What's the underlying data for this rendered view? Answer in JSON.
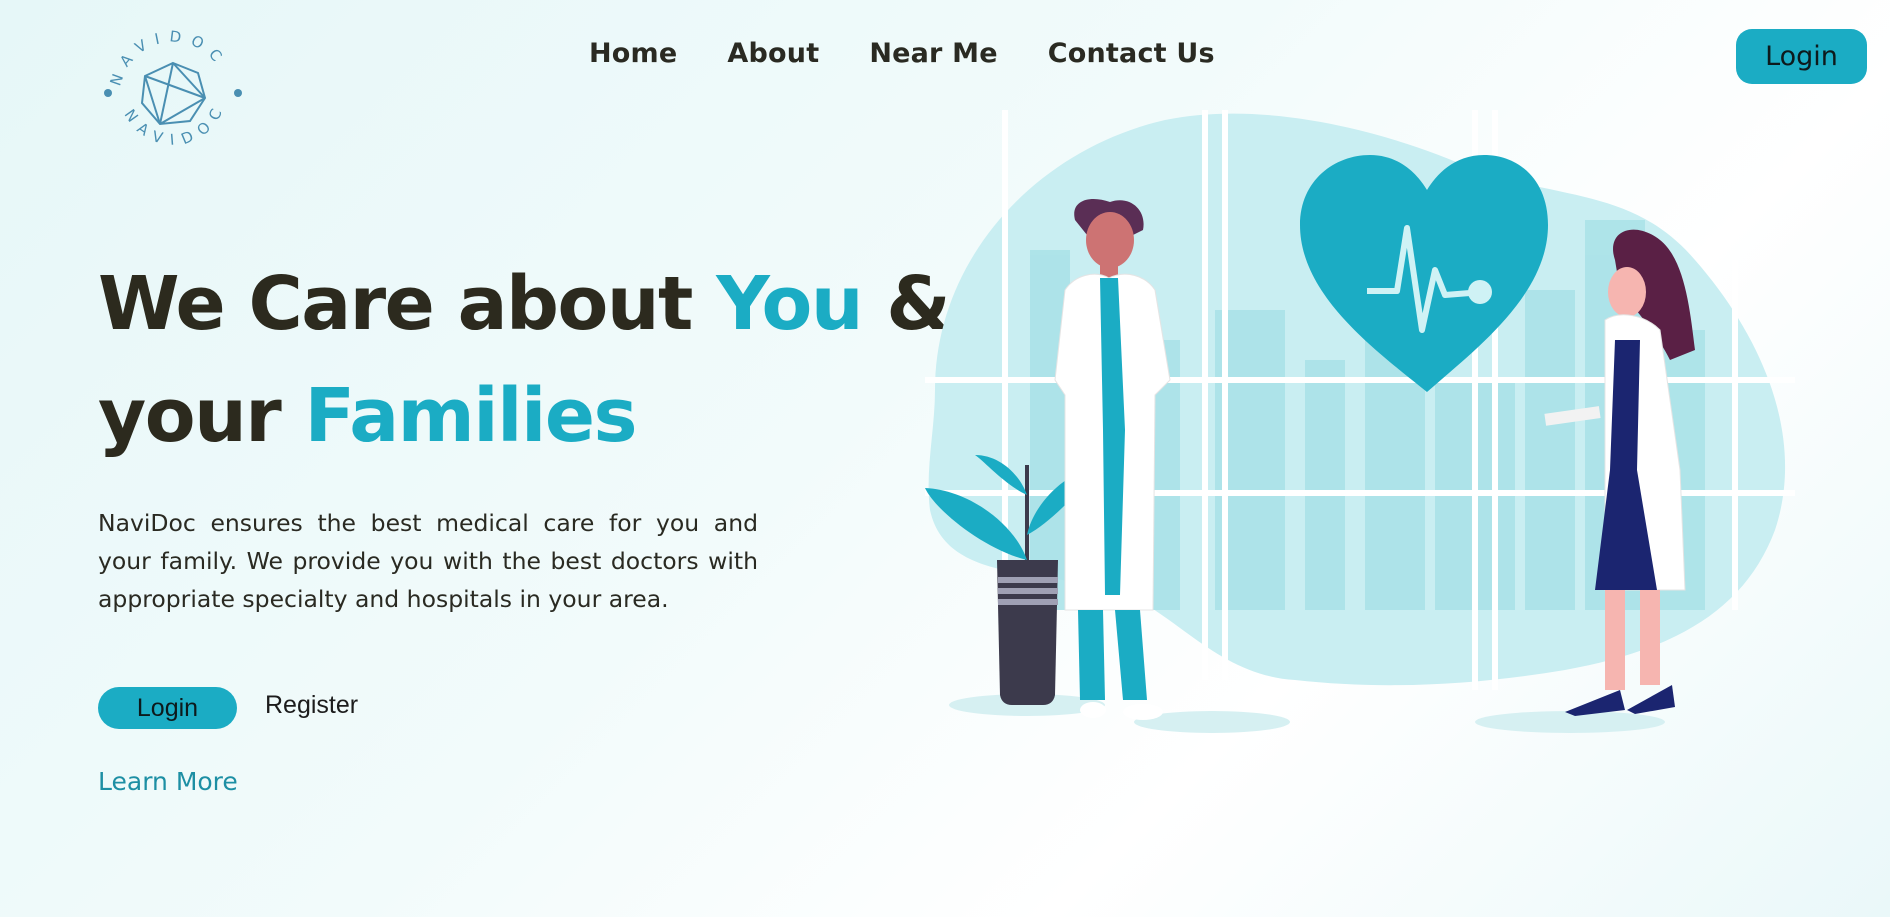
{
  "brand": {
    "logo_ring_text": "NAVIDOC",
    "accent_color": "#1bacc4",
    "dark_text_color": "#2c2a1e"
  },
  "nav": {
    "items": [
      {
        "label": "Home"
      },
      {
        "label": "About"
      },
      {
        "label": "Near Me"
      },
      {
        "label": "Contact Us"
      }
    ],
    "login_label": "Login"
  },
  "hero": {
    "title_part1": "We Care about ",
    "title_accent1": "You",
    "title_part2": " &",
    "title_part3": "your ",
    "title_accent2": "Families",
    "description": "NaviDoc ensures the best medical care for you and your family. We provide you with the best doctors with appropriate specialty and hospitals in your area.",
    "login_label": "Login",
    "register_label": "Register",
    "learn_more_label": "Learn More"
  },
  "illustration": {
    "icons": [
      "heart-pulse-icon",
      "male-doctor",
      "female-doctor",
      "potted-plant",
      "city-skyline"
    ]
  }
}
